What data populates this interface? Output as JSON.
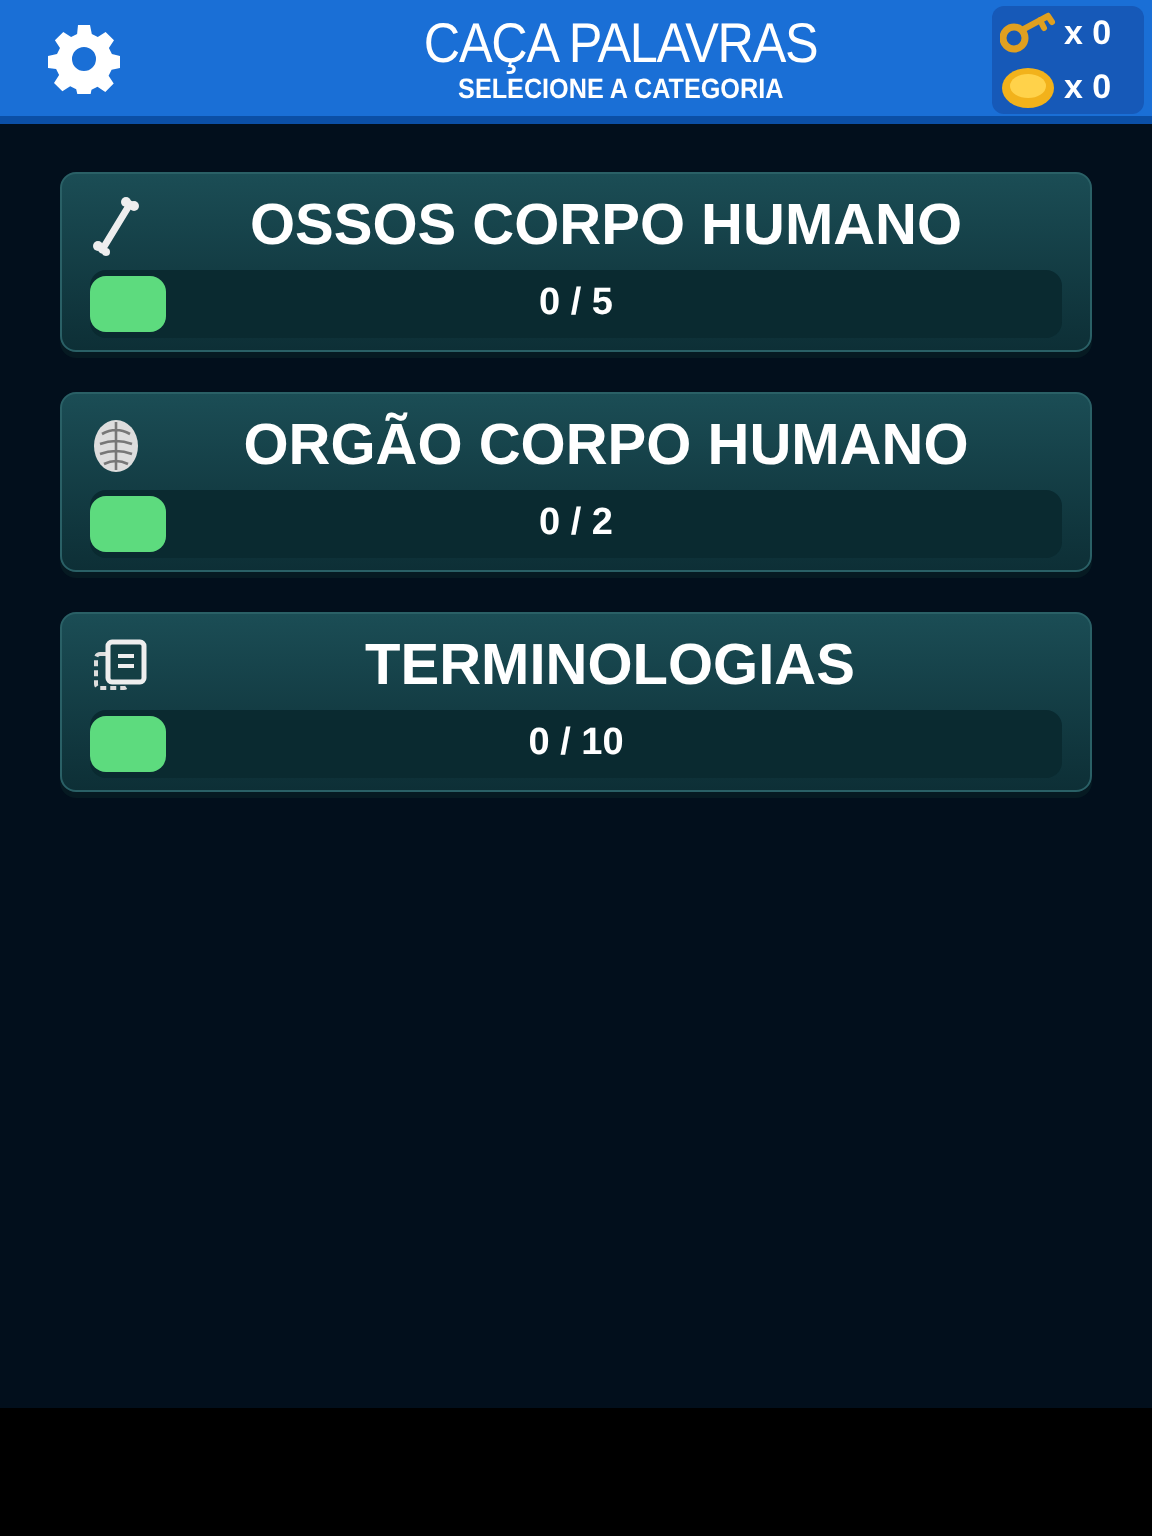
{
  "header": {
    "title": "CAÇA PALAVRAS",
    "subtitle": "SELECIONE A CATEGORIA",
    "counters": [
      {
        "kind": "key",
        "count": "x 0"
      },
      {
        "kind": "coin",
        "count": "x 0"
      }
    ]
  },
  "categories": [
    {
      "kind": "bone",
      "name": "OSSOS CORPO HUMANO",
      "progress": "0 / 5",
      "level": 0
    },
    {
      "kind": "organ",
      "name": "ORGÃO CORPO HUMANO",
      "progress": "0 / 2",
      "level": 0
    },
    {
      "kind": "cards",
      "name": "TERMINOLOGIAS",
      "progress": "0 / 10",
      "level": 0
    }
  ]
}
